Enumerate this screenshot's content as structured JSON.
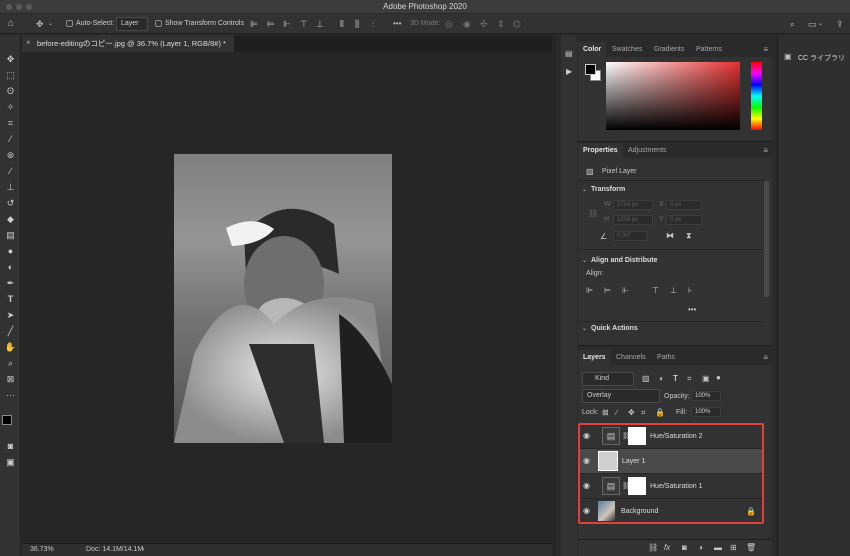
{
  "window": {
    "title": "Adobe Photoshop 2020"
  },
  "options_bar": {
    "auto_select_label": "Auto-Select:",
    "auto_select_value": "Layer",
    "show_transform_label": "Show Transform Controls",
    "three_d_mode": "3D Mode:",
    "more": "•••"
  },
  "document": {
    "tab_title": "before-editingのコピー.jpg @ 36.7% (Layer 1, RGB/8#) *",
    "zoom": "36.73%",
    "doc_info": "Doc: 14.1M/14.1M"
  },
  "color_panel": {
    "tabs": [
      "Color",
      "Swatches",
      "Gradients",
      "Patterns"
    ]
  },
  "properties_panel": {
    "tabs": [
      "Properties",
      "Adjustments"
    ],
    "kind": "Pixel Layer",
    "transform_header": "Transform",
    "w_label": "W",
    "w_value": "1754 px",
    "h_label": "H",
    "h_value": "1200 px",
    "x_label": "X",
    "x_value": "0 px",
    "y_label": "Y",
    "y_value": "0 px",
    "angle_value": "0.00°",
    "align_header": "Align and Distribute",
    "align_label": "Align:",
    "more": "•••",
    "quick_actions_header": "Quick Actions"
  },
  "layers_panel": {
    "tabs": [
      "Layers",
      "Channels",
      "Paths"
    ],
    "kind_filter": "Kind",
    "blend_mode": "Overlay",
    "opacity_label": "Opacity:",
    "opacity_value": "100%",
    "lock_label": "Lock:",
    "fill_label": "Fill:",
    "fill_value": "100%",
    "layers": [
      {
        "name": "Hue/Saturation 2",
        "type": "adjustment",
        "selected": false
      },
      {
        "name": "Layer 1",
        "type": "pixel",
        "selected": true
      },
      {
        "name": "Hue/Saturation 1",
        "type": "adjustment",
        "selected": false
      },
      {
        "name": "Background",
        "type": "image",
        "selected": false,
        "locked": true
      }
    ],
    "highlight_color": "#e0413f"
  },
  "cc_libraries": {
    "label": "CC ライブラリ"
  },
  "icons": [
    "home-icon",
    "move-icon",
    "search-icon",
    "workspace-icon",
    "share-icon",
    "eye-icon",
    "lock-icon",
    "panel-menu-icon"
  ]
}
